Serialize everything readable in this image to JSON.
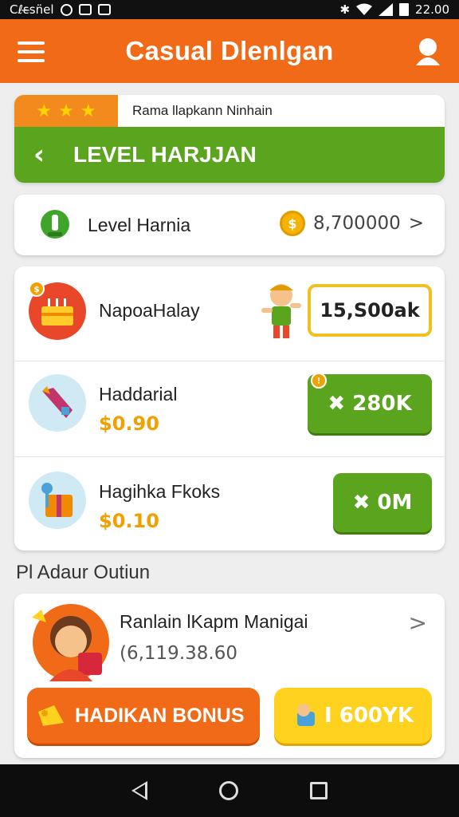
{
  "status_bar": {
    "left_text": "Cℓε̶sn̈el",
    "time": "22.00",
    "icons": [
      "alarm-icon",
      "image-icon",
      "download-icon",
      "bluetooth-icon",
      "wifi-icon",
      "signal-icon",
      "battery-icon"
    ]
  },
  "app_bar": {
    "title": "Casual Dlenlgan",
    "menu_icon": "hamburger-menu-icon",
    "profile_icon": "user-profile-icon"
  },
  "level_card": {
    "star_count": 3,
    "strip_text": "Rama llapkann Ninhain",
    "banner_title": "LEVEL HARJJAN",
    "back_icon": "chevron-left-icon"
  },
  "balance": {
    "label": "Level Harnia",
    "value": "8,700000",
    "coin_symbol": "$",
    "chevron": ">"
  },
  "items": [
    {
      "name": "NapoaHalay",
      "button_label": "15,S00ak",
      "badge": "$"
    },
    {
      "name": "Haddarial",
      "price": "$0.90",
      "button_label": "✖ 280K",
      "badge": "!"
    },
    {
      "name": "Hagihka Fkoks",
      "price": "$0.10",
      "button_label": "✖ 0M"
    }
  ],
  "section_heading": "Pl Adaur Outiun",
  "player": {
    "name": "Ranlain lKapm Manigai",
    "subtitle": "(6,119.38.60",
    "chevron": ">",
    "bonus_button": "HADIKAN BONUS",
    "secondary_button": "I 600YK"
  },
  "colors": {
    "orange": "#f06a17",
    "green": "#5aa41e",
    "yellow": "#ffd21f",
    "gold": "#f0a000"
  }
}
